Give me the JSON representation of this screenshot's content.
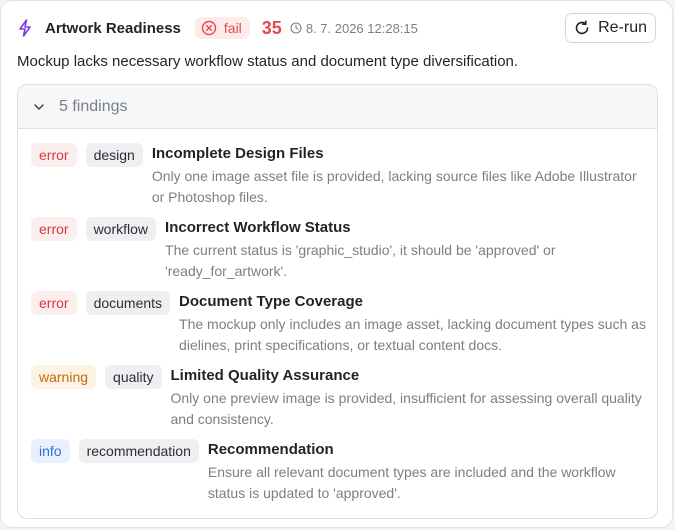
{
  "header": {
    "icon": "bolt-icon",
    "title": "Artwork Readiness",
    "status": "fail",
    "score": "35",
    "timestamp": "8. 7. 2026 12:28:15",
    "rerun_label": "Re-run"
  },
  "summary": "Mockup lacks necessary workflow status and document type diversification.",
  "findings": {
    "count_label": "5 findings",
    "items": [
      {
        "severity": "error",
        "category": "design",
        "title": "Incomplete Design Files",
        "description": "Only one image asset file is provided, lacking source files like Adobe Illustrator or Photoshop files."
      },
      {
        "severity": "error",
        "category": "workflow",
        "title": "Incorrect Workflow Status",
        "description": "The current status is 'graphic_studio', it should be 'approved' or 'ready_for_artwork'."
      },
      {
        "severity": "error",
        "category": "documents",
        "title": "Document Type Coverage",
        "description": "The mockup only includes an image asset, lacking document types such as dielines, print specifications, or textual content docs."
      },
      {
        "severity": "warning",
        "category": "quality",
        "title": "Limited Quality Assurance",
        "description": "Only one preview image is provided, insufficient for assessing overall quality and consistency."
      },
      {
        "severity": "info",
        "category": "recommendation",
        "title": "Recommendation",
        "description": "Ensure all relevant document types are included and the workflow status is updated to 'approved'."
      }
    ]
  },
  "colors": {
    "accent_purple": "#7c3aed",
    "fail_red": "#e5484d",
    "warning_orange": "#c46b12",
    "info_blue": "#2f6fd6"
  }
}
